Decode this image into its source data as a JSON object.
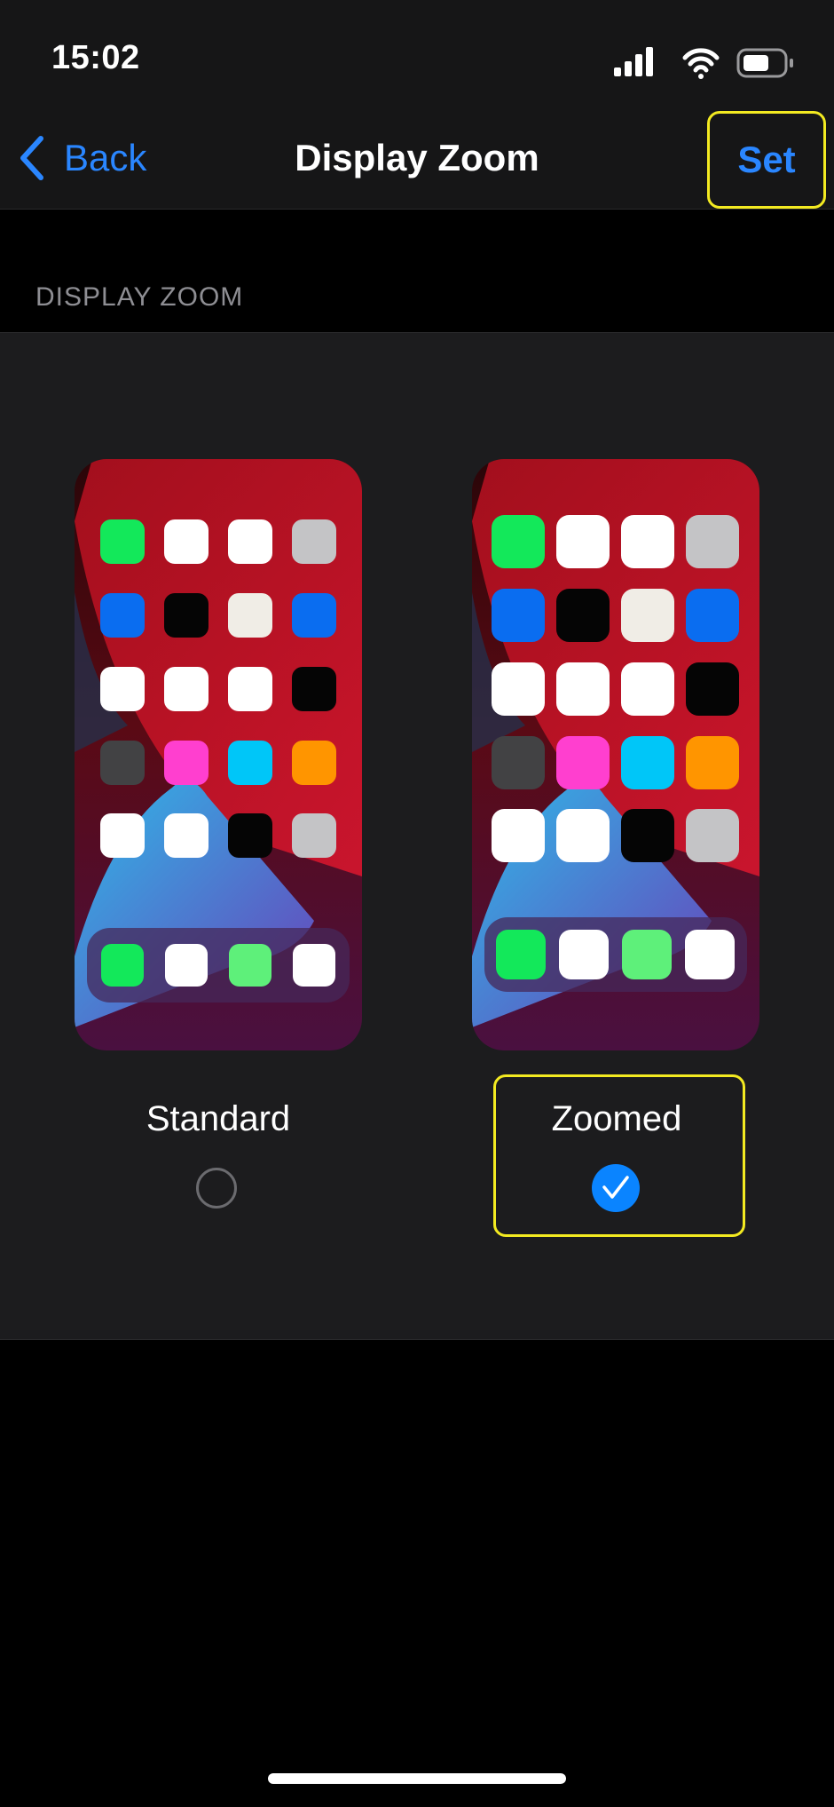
{
  "status_bar": {
    "time": "15:02"
  },
  "nav": {
    "back_label": "Back",
    "title": "Display Zoom",
    "set_label": "Set"
  },
  "section": {
    "header": "DISPLAY ZOOM"
  },
  "options": {
    "standard_label": "Standard",
    "zoomed_label": "Zoomed",
    "selected": "Zoomed"
  },
  "colors": {
    "accent": "#0a84ff",
    "highlight": "#f3ea21",
    "panel": "#1c1c1e"
  },
  "preview_icon_colors": [
    [
      "#13e85a",
      "#ffffff",
      "#ffffff",
      "#c4c4c6"
    ],
    [
      "#0a6df0",
      "#050505",
      "#f0ede6",
      "#0a6df0"
    ],
    [
      "#ffffff",
      "#ffffff",
      "#ffffff",
      "#050505"
    ],
    [
      "#424244",
      "#ff3fcf",
      "#00c6f8",
      "#ff9500"
    ],
    [
      "#ffffff",
      "#ffffff",
      "#050505",
      "#c4c4c6"
    ]
  ],
  "preview_dock_colors": [
    "#13e85a",
    "#ffffff",
    "#5ef07a",
    "#ffffff"
  ]
}
